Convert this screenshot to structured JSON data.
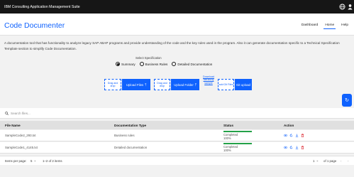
{
  "topbar": {
    "title": "IBM Consulting Application Management Suite"
  },
  "header": {
    "title": "Code Documenter",
    "nav": [
      "Dashboard",
      "Home",
      "Help"
    ],
    "active": "Home"
  },
  "description": "A documentation tool that has functionality to analyze legacy SAP ABAP programs and provide understanding of the code and the key rules used in the program. Also it can generate documentation specific to a Technical Specification Template section to simplify Code Documentation.",
  "specification": {
    "title": "Select Specification",
    "options": [
      "Summary",
      "Business Rules",
      "Detailed Documentation"
    ],
    "selected": "Summary"
  },
  "upload": {
    "drop_files": "Drag and drop",
    "upload_files": "Upload Files",
    "drop_folder": "Drag and drop",
    "upload_folder": "Upload Folder",
    "hierarchy_link": "Download hierarchy sample",
    "add_git": "add Git Files",
    "git_upload": "Git upload"
  },
  "search": {
    "placeholder": "Search files..."
  },
  "table": {
    "headers": [
      "File Name",
      "Documentation Type",
      "Status",
      "Action"
    ],
    "rows": [
      {
        "file": "SampleCode2_293.txt",
        "type": "Business rules",
        "status": "Completed",
        "progress_label": "100%",
        "progress": 1.0
      },
      {
        "file": "SampleCode1_4145.txt",
        "type": "Detailed documentation",
        "status": "Completed",
        "progress_label": "100%",
        "progress": 1.0
      }
    ]
  },
  "pagination": {
    "items_per_page_label": "Items per page:",
    "items_per_page": "5",
    "range": "1–2 of 2 items",
    "page": "1",
    "of_pages": "of 1 page"
  },
  "colors": {
    "accent": "#0f62fe",
    "success": "#24a148",
    "danger": "#da1e28",
    "topbar": "#161616"
  }
}
